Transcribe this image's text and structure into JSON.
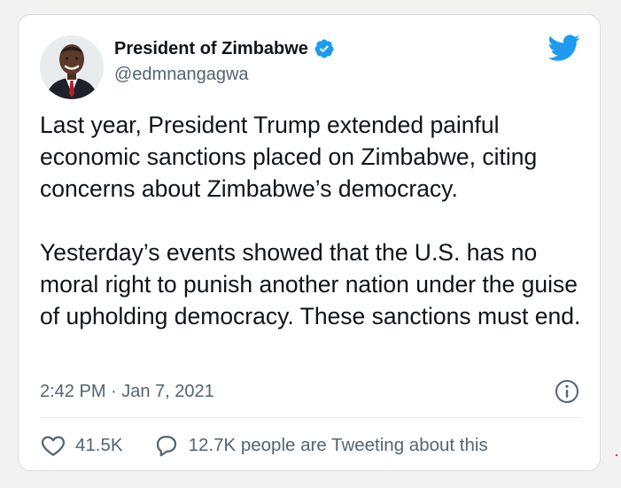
{
  "author": {
    "display_name": "President of Zimbabwe",
    "handle": "@edmnangagwa",
    "verified": true
  },
  "tweet": {
    "paragraphs": [
      "Last year, President Trump extended painful economic sanctions placed on Zimbabwe, citing concerns about Zimbabwe’s democracy.",
      "Yesterday’s events showed that the U.S. has no moral right to punish another nation under the guise of upholding democracy. These sanctions must end."
    ],
    "timestamp": "2:42 PM · Jan 7, 2021"
  },
  "actions": {
    "likes": "41.5K",
    "replies_text": "12.7K people are Tweeting about this"
  },
  "icons": {
    "brand": "twitter-bird-icon",
    "verified": "verified-badge-icon",
    "info": "info-icon",
    "like": "heart-icon",
    "reply": "speech-bubble-icon"
  },
  "colors": {
    "brand_blue": "#1d9bf0",
    "text_primary": "#0f1419",
    "text_secondary": "#536471",
    "background": "#f2f2f2",
    "card_border": "#d6dbdf"
  }
}
